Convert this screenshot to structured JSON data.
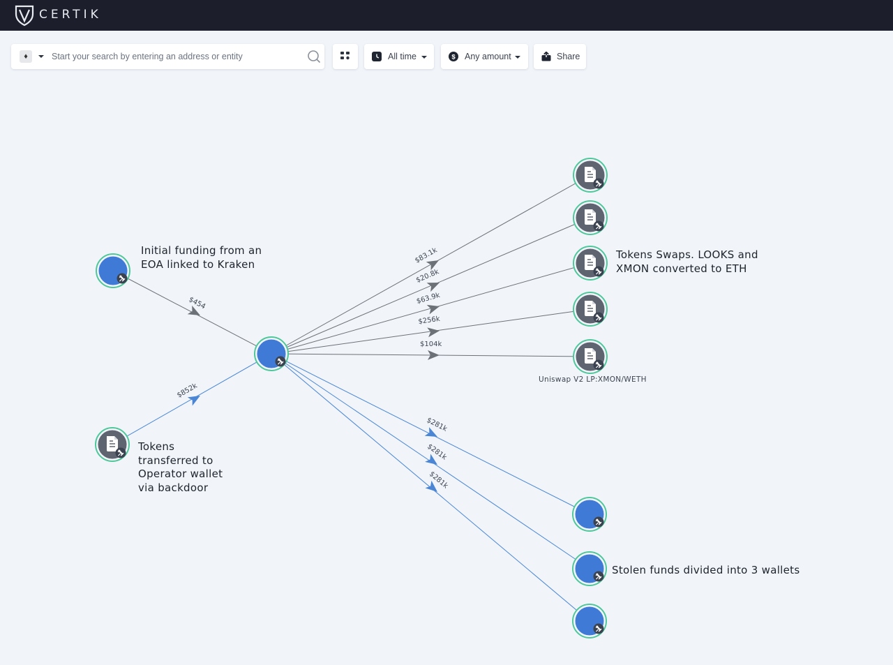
{
  "app": {
    "brand": "CERTIK"
  },
  "search": {
    "chain_icon": "ethereum-icon",
    "placeholder": "Start your search by entering an address or entity",
    "value": ""
  },
  "toolbar": {
    "time_label": "All time",
    "amount_label": "Any amount",
    "share_label": "Share"
  },
  "graph": {
    "edges": [
      {
        "id": "e-in1",
        "label": "$454"
      },
      {
        "id": "e-in2",
        "label": "$852k"
      },
      {
        "id": "e-o1",
        "label": "$83.1k"
      },
      {
        "id": "e-o2",
        "label": "$20.8k"
      },
      {
        "id": "e-o3",
        "label": "$63.9k"
      },
      {
        "id": "e-o4",
        "label": "$256k"
      },
      {
        "id": "e-o5",
        "label": "$104k"
      },
      {
        "id": "e-w1",
        "label": "$281k"
      },
      {
        "id": "e-w2",
        "label": "$281k"
      },
      {
        "id": "e-w3",
        "label": "$281k"
      }
    ],
    "node_caption": "Uniswap V2 LP:XMON/WETH",
    "annotations": {
      "kraken": "Initial funding from an EOA linked to Kraken",
      "swaps": "Tokens Swaps. LOOKS and XMON converted to ETH",
      "backdoor": "Tokens transferred to Operator wallet via backdoor",
      "stolen": "Stolen funds divided into 3 wallets"
    }
  },
  "colors": {
    "wallet": "#3f7bd6",
    "contract": "#5e6470",
    "ring": "#4fc79a",
    "edge_gray": "#6c7178",
    "edge_blue": "#4a86d4"
  }
}
